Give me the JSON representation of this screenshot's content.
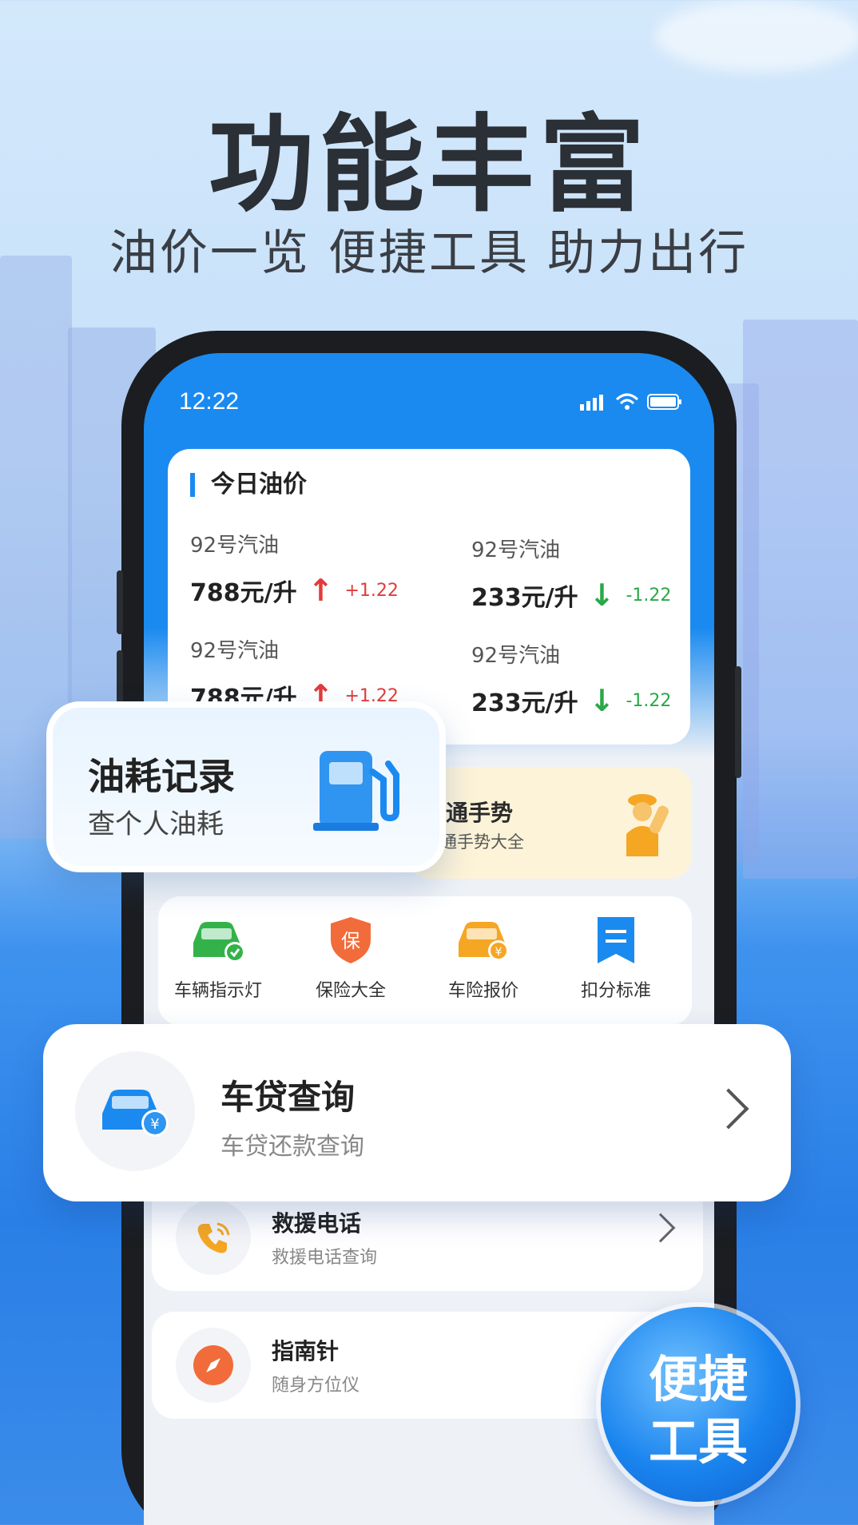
{
  "hero": {
    "title": "功能丰富",
    "subtitle": "油价一览 便捷工具 助力出行"
  },
  "status_bar": {
    "time": "12:22"
  },
  "oil_prices": {
    "title": "今日油价",
    "items": [
      {
        "name": "92号汽油",
        "price": "788元/升",
        "direction": "up",
        "change": "+1.22"
      },
      {
        "name": "92号汽油",
        "price": "233元/升",
        "direction": "down",
        "change": "-1.22"
      },
      {
        "name": "92号汽油",
        "price": "788元/升",
        "direction": "up",
        "change": "+1.22"
      },
      {
        "name": "92号汽油",
        "price": "233元/升",
        "direction": "down",
        "change": "-1.22"
      }
    ]
  },
  "fuel_record": {
    "title": "油耗记录",
    "subtitle": "查个人油耗",
    "icon": "fuel-pump-icon"
  },
  "traffic_gestures": {
    "title": "交通手势",
    "subtitle": "交通手势大全",
    "icon": "traffic-police-icon"
  },
  "tools": [
    {
      "label": "车辆指示灯",
      "icon": "car-indicator-icon",
      "color": "#34b24a"
    },
    {
      "label": "保险大全",
      "icon": "insurance-shield-icon",
      "color": "#f26b3a"
    },
    {
      "label": "车险报价",
      "icon": "car-insurance-quote-icon",
      "color": "#f5a623"
    },
    {
      "label": "扣分标准",
      "icon": "deduction-standard-icon",
      "color": "#1a8af0"
    }
  ],
  "car_loan": {
    "title": "车贷查询",
    "subtitle": "车贷还款查询",
    "icon": "car-loan-icon"
  },
  "list": [
    {
      "title": "救援电话",
      "subtitle": "救援电话查询",
      "icon": "phone-icon",
      "color": "#f5a623"
    },
    {
      "title": "指南针",
      "subtitle": "随身方位仪",
      "icon": "compass-icon",
      "color": "#f26b3a"
    }
  ],
  "bubble": {
    "line1": "便捷",
    "line2": "工具"
  },
  "colors": {
    "primary": "#1a8af0",
    "up": "#e23b3b",
    "down": "#2aa848"
  }
}
